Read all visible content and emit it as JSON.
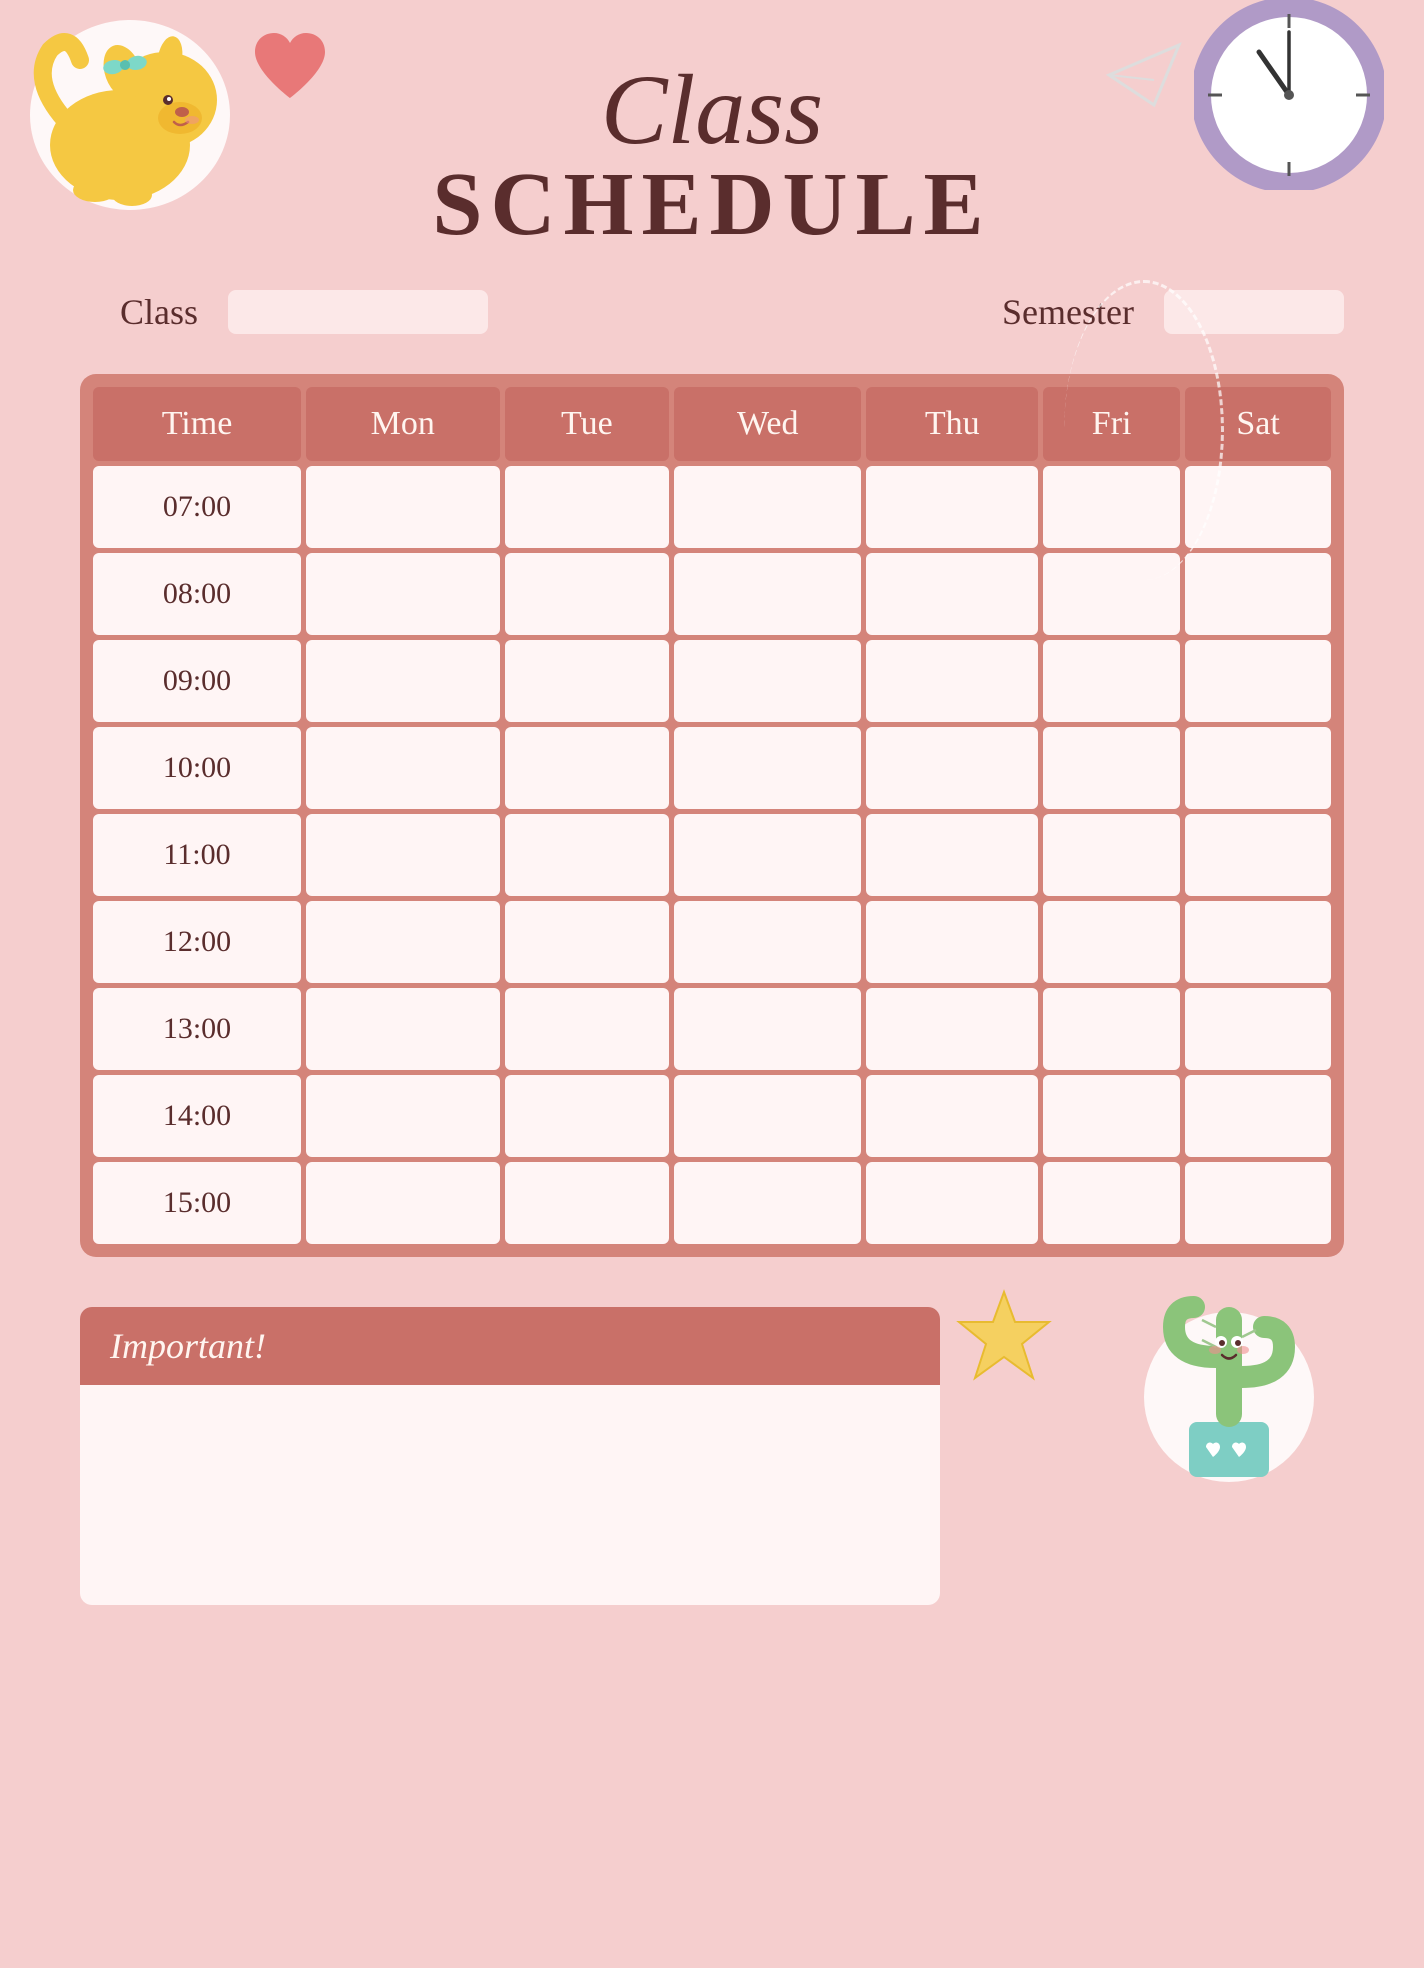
{
  "header": {
    "title_class": "Class",
    "title_schedule": "SCHEDULE"
  },
  "fields": {
    "class_label": "Class",
    "semester_label": "Semester"
  },
  "table": {
    "headers": [
      "Time",
      "Mon",
      "Tue",
      "Wed",
      "Thu",
      "Fri",
      "Sat"
    ],
    "rows": [
      {
        "time": "07:00",
        "cells": [
          "",
          "",
          "",
          "",
          "",
          ""
        ]
      },
      {
        "time": "08:00",
        "cells": [
          "",
          "",
          "",
          "",
          "",
          ""
        ]
      },
      {
        "time": "09:00",
        "cells": [
          "",
          "",
          "",
          "",
          "",
          ""
        ]
      },
      {
        "time": "10:00",
        "cells": [
          "",
          "",
          "",
          "",
          "",
          ""
        ]
      },
      {
        "time": "11:00",
        "cells": [
          "",
          "",
          "",
          "",
          "",
          ""
        ]
      },
      {
        "time": "12:00",
        "cells": [
          "",
          "",
          "",
          "",
          "",
          ""
        ]
      },
      {
        "time": "13:00",
        "cells": [
          "",
          "",
          "",
          "",
          "",
          ""
        ]
      },
      {
        "time": "14:00",
        "cells": [
          "",
          "",
          "",
          "",
          "",
          ""
        ]
      },
      {
        "time": "15:00",
        "cells": [
          "",
          "",
          "",
          "",
          "",
          ""
        ]
      }
    ]
  },
  "important": {
    "label": "Important!"
  },
  "colors": {
    "bg": "#f5cece",
    "header_bg": "#c97068",
    "table_bg": "#d4847a",
    "cell_bg": "#fff5f5",
    "text_dark": "#5a2d2d",
    "text_light": "#fff5f0"
  }
}
